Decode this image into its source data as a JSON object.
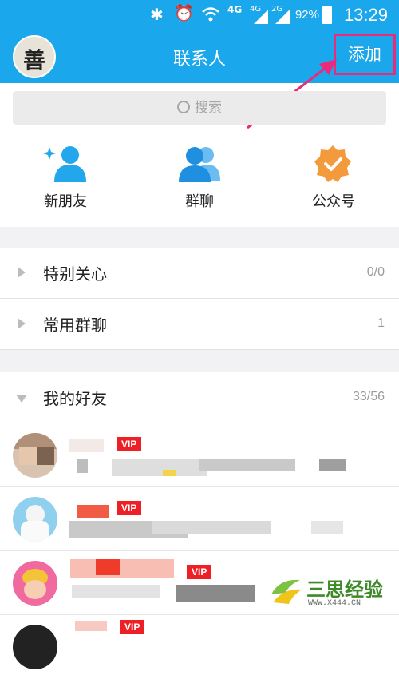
{
  "status_bar": {
    "network": "4G",
    "sig1": "4G",
    "sig2": "2G",
    "battery": "92%",
    "time": "13:29"
  },
  "header": {
    "title": "联系人",
    "add_label": "添加",
    "profile_glyph": "善"
  },
  "search": {
    "placeholder": "搜索"
  },
  "quick_actions": [
    {
      "label": "新朋友",
      "icon": "new-friend-icon"
    },
    {
      "label": "群聊",
      "icon": "group-chat-icon"
    },
    {
      "label": "公众号",
      "icon": "official-account-icon"
    }
  ],
  "groups": [
    {
      "name": "特别关心",
      "count": "0/0"
    },
    {
      "name": "常用群聊",
      "count": "1"
    },
    {
      "name": "我的好友",
      "count": "33/56"
    }
  ],
  "friends": [
    {
      "badge": "VIP"
    },
    {
      "badge": "VIP"
    },
    {
      "badge": "VIP"
    },
    {
      "badge": "VIP"
    }
  ],
  "watermark": {
    "name": "三思经验",
    "url": "WWW.X444.CN"
  },
  "colors": {
    "header": "#1aa7ec",
    "highlight": "#ea2a7a",
    "vip": "#ef1f26",
    "accent_orange": "#f39a3c"
  }
}
